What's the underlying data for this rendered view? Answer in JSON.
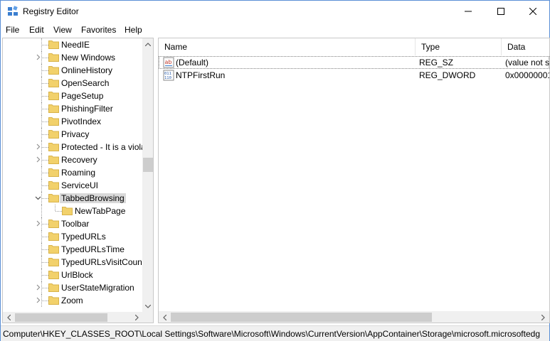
{
  "window": {
    "title": "Registry Editor",
    "icons": {
      "app": "registry-editor-icon",
      "minimize": "minimize-icon",
      "maximize": "maximize-icon",
      "close": "close-icon"
    }
  },
  "menu": {
    "file": "File",
    "edit": "Edit",
    "view": "View",
    "favorites": "Favorites",
    "help": "Help"
  },
  "tree": {
    "items": [
      {
        "label": "NeedIE",
        "expandable": false
      },
      {
        "label": "New Windows",
        "expandable": true
      },
      {
        "label": "OnlineHistory",
        "expandable": false
      },
      {
        "label": "OpenSearch",
        "expandable": false
      },
      {
        "label": "PageSetup",
        "expandable": false
      },
      {
        "label": "PhishingFilter",
        "expandable": false
      },
      {
        "label": "PivotIndex",
        "expandable": false
      },
      {
        "label": "Privacy",
        "expandable": false
      },
      {
        "label": "Protected - It is a viola",
        "expandable": true
      },
      {
        "label": "Recovery",
        "expandable": true
      },
      {
        "label": "Roaming",
        "expandable": false
      },
      {
        "label": "ServiceUI",
        "expandable": false
      },
      {
        "label": "TabbedBrowsing",
        "expandable": true,
        "expanded": true,
        "selected": true
      },
      {
        "label": "NewTabPage",
        "child": true
      },
      {
        "label": "Toolbar",
        "expandable": true
      },
      {
        "label": "TypedURLs",
        "expandable": false
      },
      {
        "label": "TypedURLsTime",
        "expandable": false
      },
      {
        "label": "TypedURLsVisitCount",
        "expandable": false
      },
      {
        "label": "UrlBlock",
        "expandable": false
      },
      {
        "label": "UserStateMigration",
        "expandable": true
      },
      {
        "label": "Zoom",
        "expandable": true
      }
    ]
  },
  "list": {
    "columns": {
      "name": "Name",
      "type": "Type",
      "data": "Data"
    },
    "rows": [
      {
        "name": "(Default)",
        "type": "REG_SZ",
        "data": "(value not s",
        "icon": "string-value-icon"
      },
      {
        "name": "NTPFirstRun",
        "type": "REG_DWORD",
        "data": "0x00000001",
        "icon": "binary-value-icon"
      }
    ]
  },
  "status": {
    "path": "Computer\\HKEY_CLASSES_ROOT\\Local Settings\\Software\\Microsoft\\Windows\\CurrentVersion\\AppContainer\\Storage\\microsoft.microsoftedg"
  },
  "colors": {
    "folder": "#f2d16b",
    "folder_edge": "#d8b34a",
    "selection": "#d9d9d9",
    "border": "#5a8fd6"
  }
}
